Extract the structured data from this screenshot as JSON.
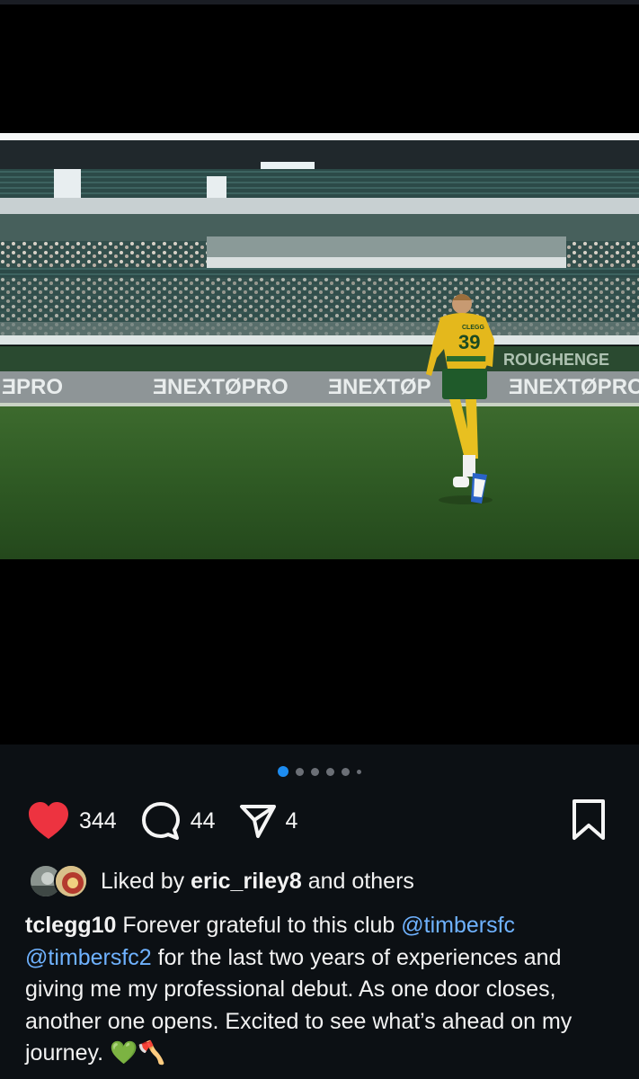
{
  "post": {
    "carousel": {
      "count": 6,
      "active_index": 0
    },
    "actions": {
      "likes": "344",
      "comments": "44",
      "shares": "4"
    },
    "liked_by": {
      "prefix": "Liked by",
      "user": "eric_riley8",
      "suffix": "and others"
    },
    "caption": {
      "username": "tclegg10",
      "text_1": " Forever grateful to this club ",
      "mention_1": "@timbersfc",
      "text_2": " ",
      "mention_2": "@timbersfc2",
      "text_3": " for the last two years of experiences and giving me my professional debut. As one door closes, another one opens. Excited to see what’s ahead on my journey. 💚🪓"
    },
    "photo_text": {
      "jersey_number": "39",
      "jersey_name": "CLEGG",
      "boards_left": "ƎPRO",
      "boards_mid": "ƎNEXTØPRO",
      "boards_mid2": "ƎNEXTØP",
      "boards_right": "ƎNEXTØPRO",
      "boards_upper": "ROUGHENGE"
    },
    "colors": {
      "heart": "#ed3340",
      "mention": "#6fb2ff",
      "active_dot": "#1d8cf0",
      "background": "#0c1014"
    },
    "icons": [
      "heart-icon",
      "comment-icon",
      "share-icon",
      "bookmark-icon"
    ]
  }
}
